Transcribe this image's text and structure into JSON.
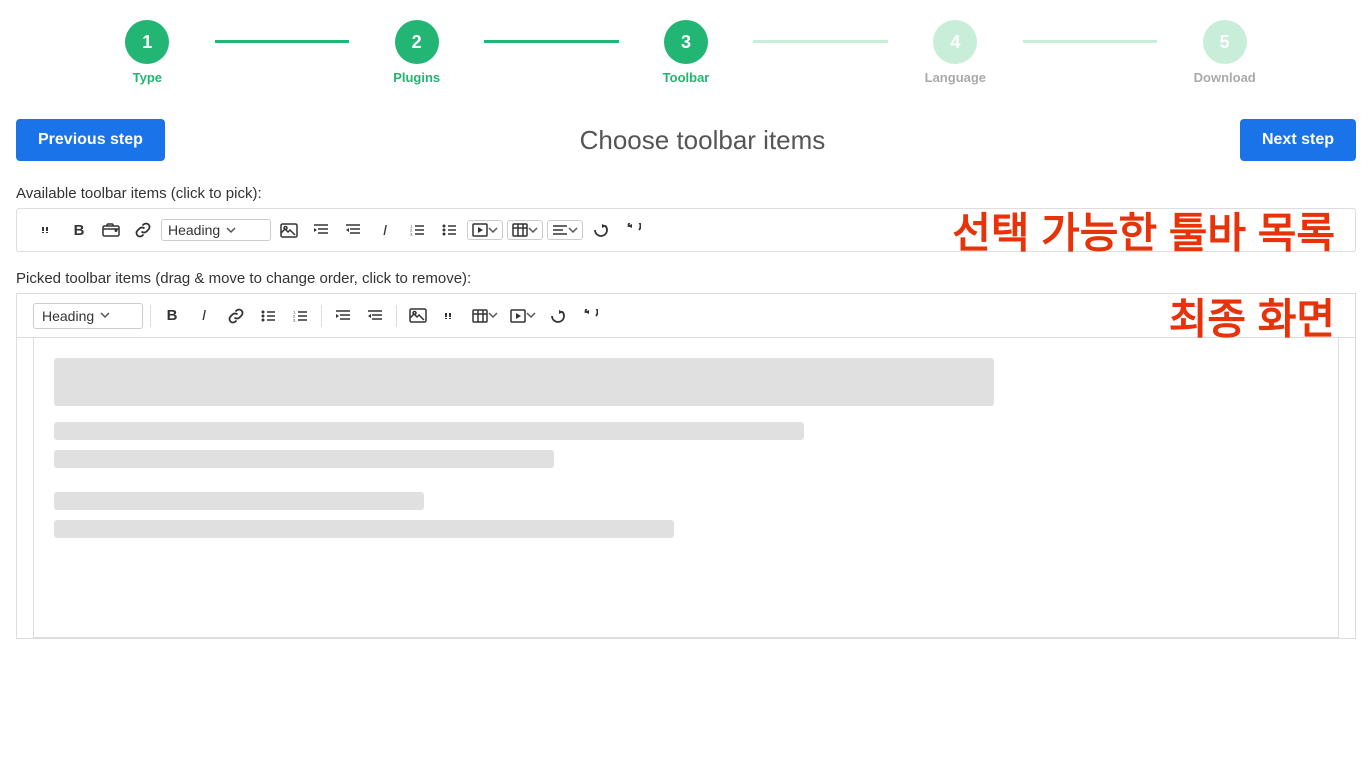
{
  "stepper": {
    "steps": [
      {
        "number": "1",
        "label": "Type",
        "state": "active"
      },
      {
        "number": "2",
        "label": "Plugins",
        "state": "active"
      },
      {
        "number": "3",
        "label": "Toolbar",
        "state": "active"
      },
      {
        "number": "4",
        "label": "Language",
        "state": "inactive"
      },
      {
        "number": "5",
        "label": "Download",
        "state": "inactive"
      }
    ],
    "connectors": [
      "filled",
      "filled",
      "filled",
      "empty"
    ]
  },
  "actions": {
    "prev_label": "Previous step",
    "next_label": "Next step",
    "page_title": "Choose toolbar items"
  },
  "available_label": "Available toolbar items (click to pick):",
  "picked_label": "Picked toolbar items (drag & move to change order, click to remove):",
  "heading_select": "Heading",
  "watermark1": "선택 가능한 툴바 목록",
  "watermark2": "최종 화면",
  "available_toolbar": {
    "items": [
      {
        "icon": "quote",
        "title": "Blockquote"
      },
      {
        "icon": "bold",
        "title": "Bold"
      },
      {
        "icon": "browse-files",
        "title": "Browse files"
      },
      {
        "icon": "link",
        "title": "Link"
      },
      {
        "icon": "heading-dropdown",
        "title": "Heading"
      },
      {
        "icon": "image",
        "title": "Image"
      },
      {
        "icon": "indent-right",
        "title": "Indent right"
      },
      {
        "icon": "indent-left",
        "title": "Indent left"
      },
      {
        "icon": "italic",
        "title": "Italic"
      },
      {
        "icon": "ordered-list",
        "title": "Ordered list"
      },
      {
        "icon": "unordered-list",
        "title": "Unordered list"
      },
      {
        "icon": "media",
        "title": "Media"
      },
      {
        "icon": "table",
        "title": "Table"
      },
      {
        "icon": "align",
        "title": "Alignment"
      },
      {
        "icon": "undo",
        "title": "Undo"
      },
      {
        "icon": "redo",
        "title": "Redo"
      }
    ]
  },
  "picked_toolbar": {
    "items": [
      {
        "icon": "heading-dropdown-picked",
        "title": "Heading"
      },
      {
        "icon": "bold",
        "title": "Bold"
      },
      {
        "icon": "italic",
        "title": "Italic"
      },
      {
        "icon": "link",
        "title": "Link"
      },
      {
        "icon": "unordered-list",
        "title": "Unordered list"
      },
      {
        "icon": "ordered-list",
        "title": "Ordered list"
      },
      {
        "icon": "sep1",
        "title": "sep"
      },
      {
        "icon": "indent-right",
        "title": "Indent right"
      },
      {
        "icon": "indent-left",
        "title": "Indent left"
      },
      {
        "icon": "sep2",
        "title": "sep"
      },
      {
        "icon": "image",
        "title": "Image"
      },
      {
        "icon": "quote",
        "title": "Blockquote"
      },
      {
        "icon": "table",
        "title": "Table"
      },
      {
        "icon": "media",
        "title": "Media"
      },
      {
        "icon": "undo",
        "title": "Undo"
      },
      {
        "icon": "redo",
        "title": "Redo"
      }
    ]
  },
  "preview": {
    "lines": [
      {
        "width": "940",
        "height": "48"
      },
      {
        "width": "750",
        "height": "18"
      },
      {
        "width": "500",
        "height": "18"
      },
      {
        "width": "370",
        "height": "18"
      },
      {
        "width": "620",
        "height": "18"
      }
    ]
  }
}
